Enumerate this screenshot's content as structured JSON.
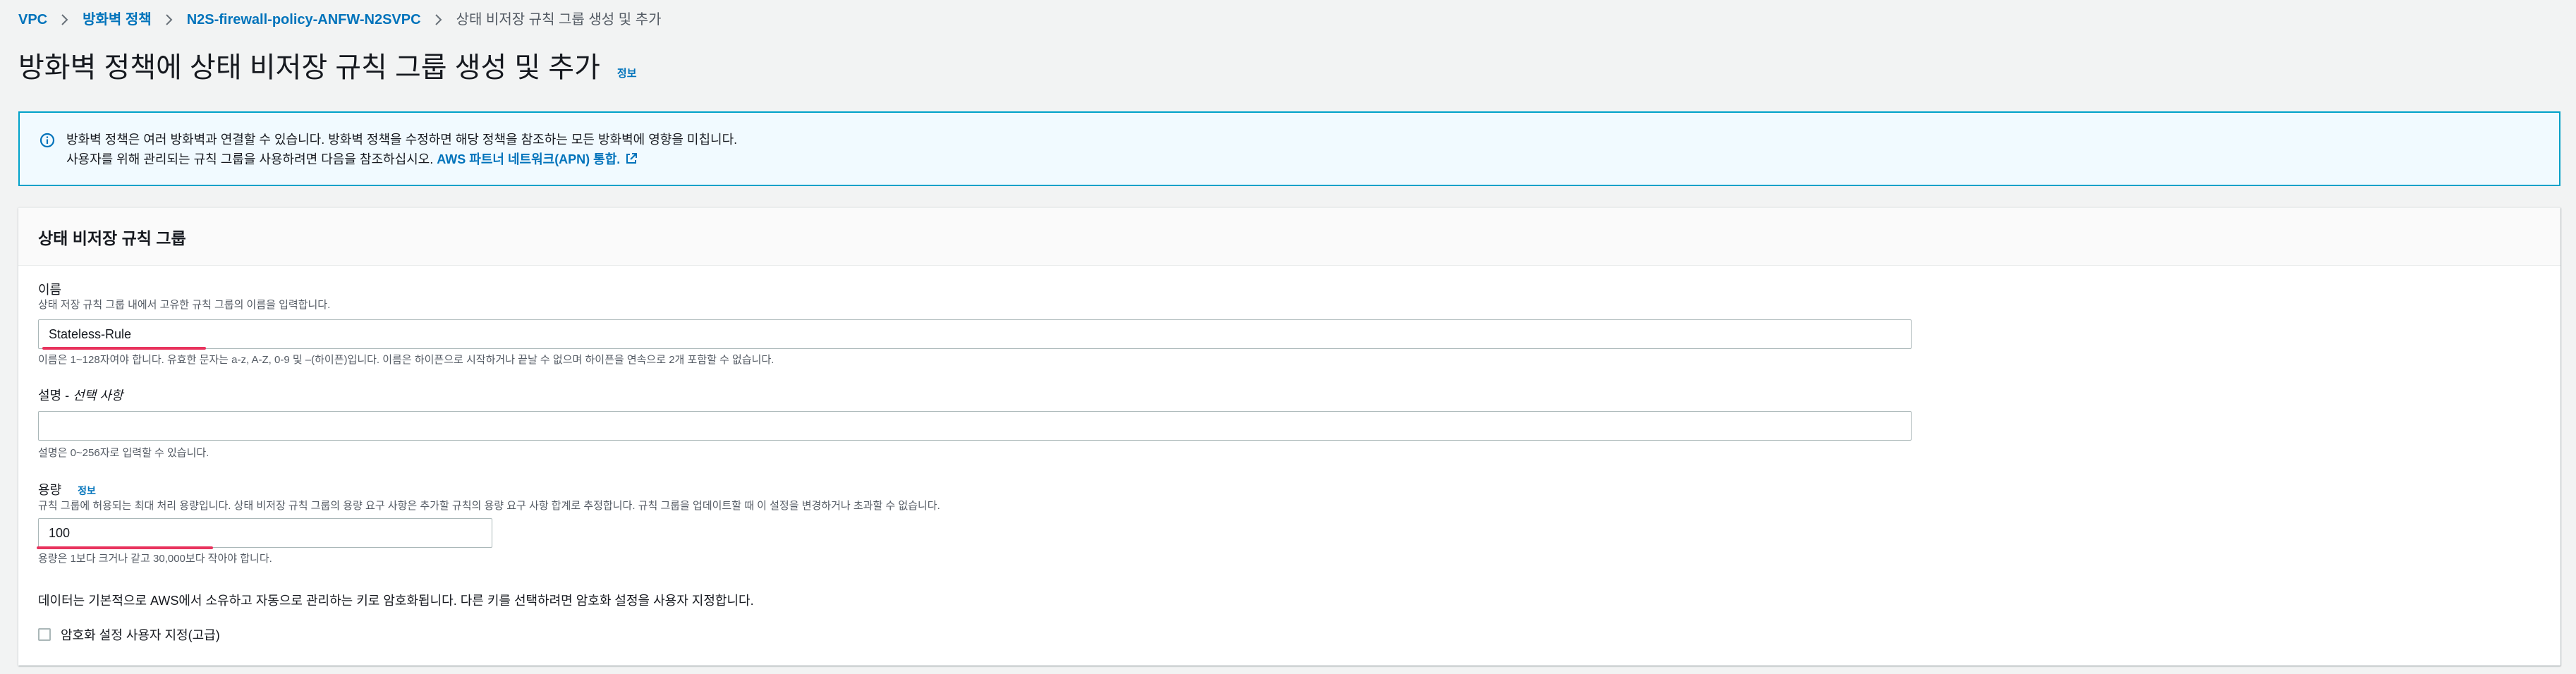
{
  "breadcrumb": {
    "items": [
      "VPC",
      "방화벽 정책",
      "N2S-firewall-policy-ANFW-N2SVPC"
    ],
    "current": "상태 비저장 규칙 그룹 생성 및 추가"
  },
  "header": {
    "title": "방화벽 정책에 상태 비저장 규칙 그룹 생성 및 추가",
    "info": "정보"
  },
  "alert": {
    "line1": "방화벽 정책은 여러 방화벽과 연결할 수 있습니다. 방화벽 정책을 수정하면 해당 정책을 참조하는 모든 방화벽에 영향을 미칩니다.",
    "line2_prefix": "사용자를 위해 관리되는 규칙 그룹을 사용하려면 다음을 참조하십시오.",
    "link": "AWS 파트너 네트워크(APN) 통합."
  },
  "panel": {
    "title": "상태 비저장 규칙 그룹",
    "name": {
      "label": "이름",
      "description": "상태 저장 규칙 그룹 내에서 고유한 규칙 그룹의 이름을 입력합니다.",
      "value": "Stateless-Rule",
      "constraint": "이름은 1~128자여야 합니다. 유효한 문자는 a-z, A-Z, 0-9 및 –(하이픈)입니다. 이름은 하이픈으로 시작하거나 끝날 수 없으며 하이픈을 연속으로 2개 포함할 수 없습니다."
    },
    "description_field": {
      "label": "설명 - ",
      "label_optional": "선택 사항",
      "value": "",
      "constraint": "설명은 0~256자로 입력할 수 있습니다."
    },
    "capacity": {
      "label": "용량",
      "info": "정보",
      "description": "규칙 그룹에 허용되는 최대 처리 용량입니다. 상태 비저장 규칙 그룹의 용량 요구 사항은 추가할 규칙의 용량 요구 사항 합계로 추정합니다. 규칙 그룹을 업데이트할 때 이 설정을 변경하거나 초과할 수 없습니다.",
      "value": "100",
      "constraint": "용량은 1보다 크거나 같고 30,000보다 작아야 합니다."
    },
    "encryption": {
      "text": "데이터는 기본적으로 AWS에서 소유하고 자동으로 관리하는 키로 암호화됩니다. 다른 키를 선택하려면 암호화 설정을 사용자 지정합니다.",
      "checkbox_label": "암호화 설정 사용자 지정(고급)",
      "checked": false
    }
  },
  "colors": {
    "link": "#0073bb",
    "info_border": "#00a1c9",
    "info_bg": "#f1faff",
    "highlight": "#e8335d"
  },
  "icons": [
    "chevron-right-icon",
    "info-circle-icon",
    "external-link-icon"
  ]
}
